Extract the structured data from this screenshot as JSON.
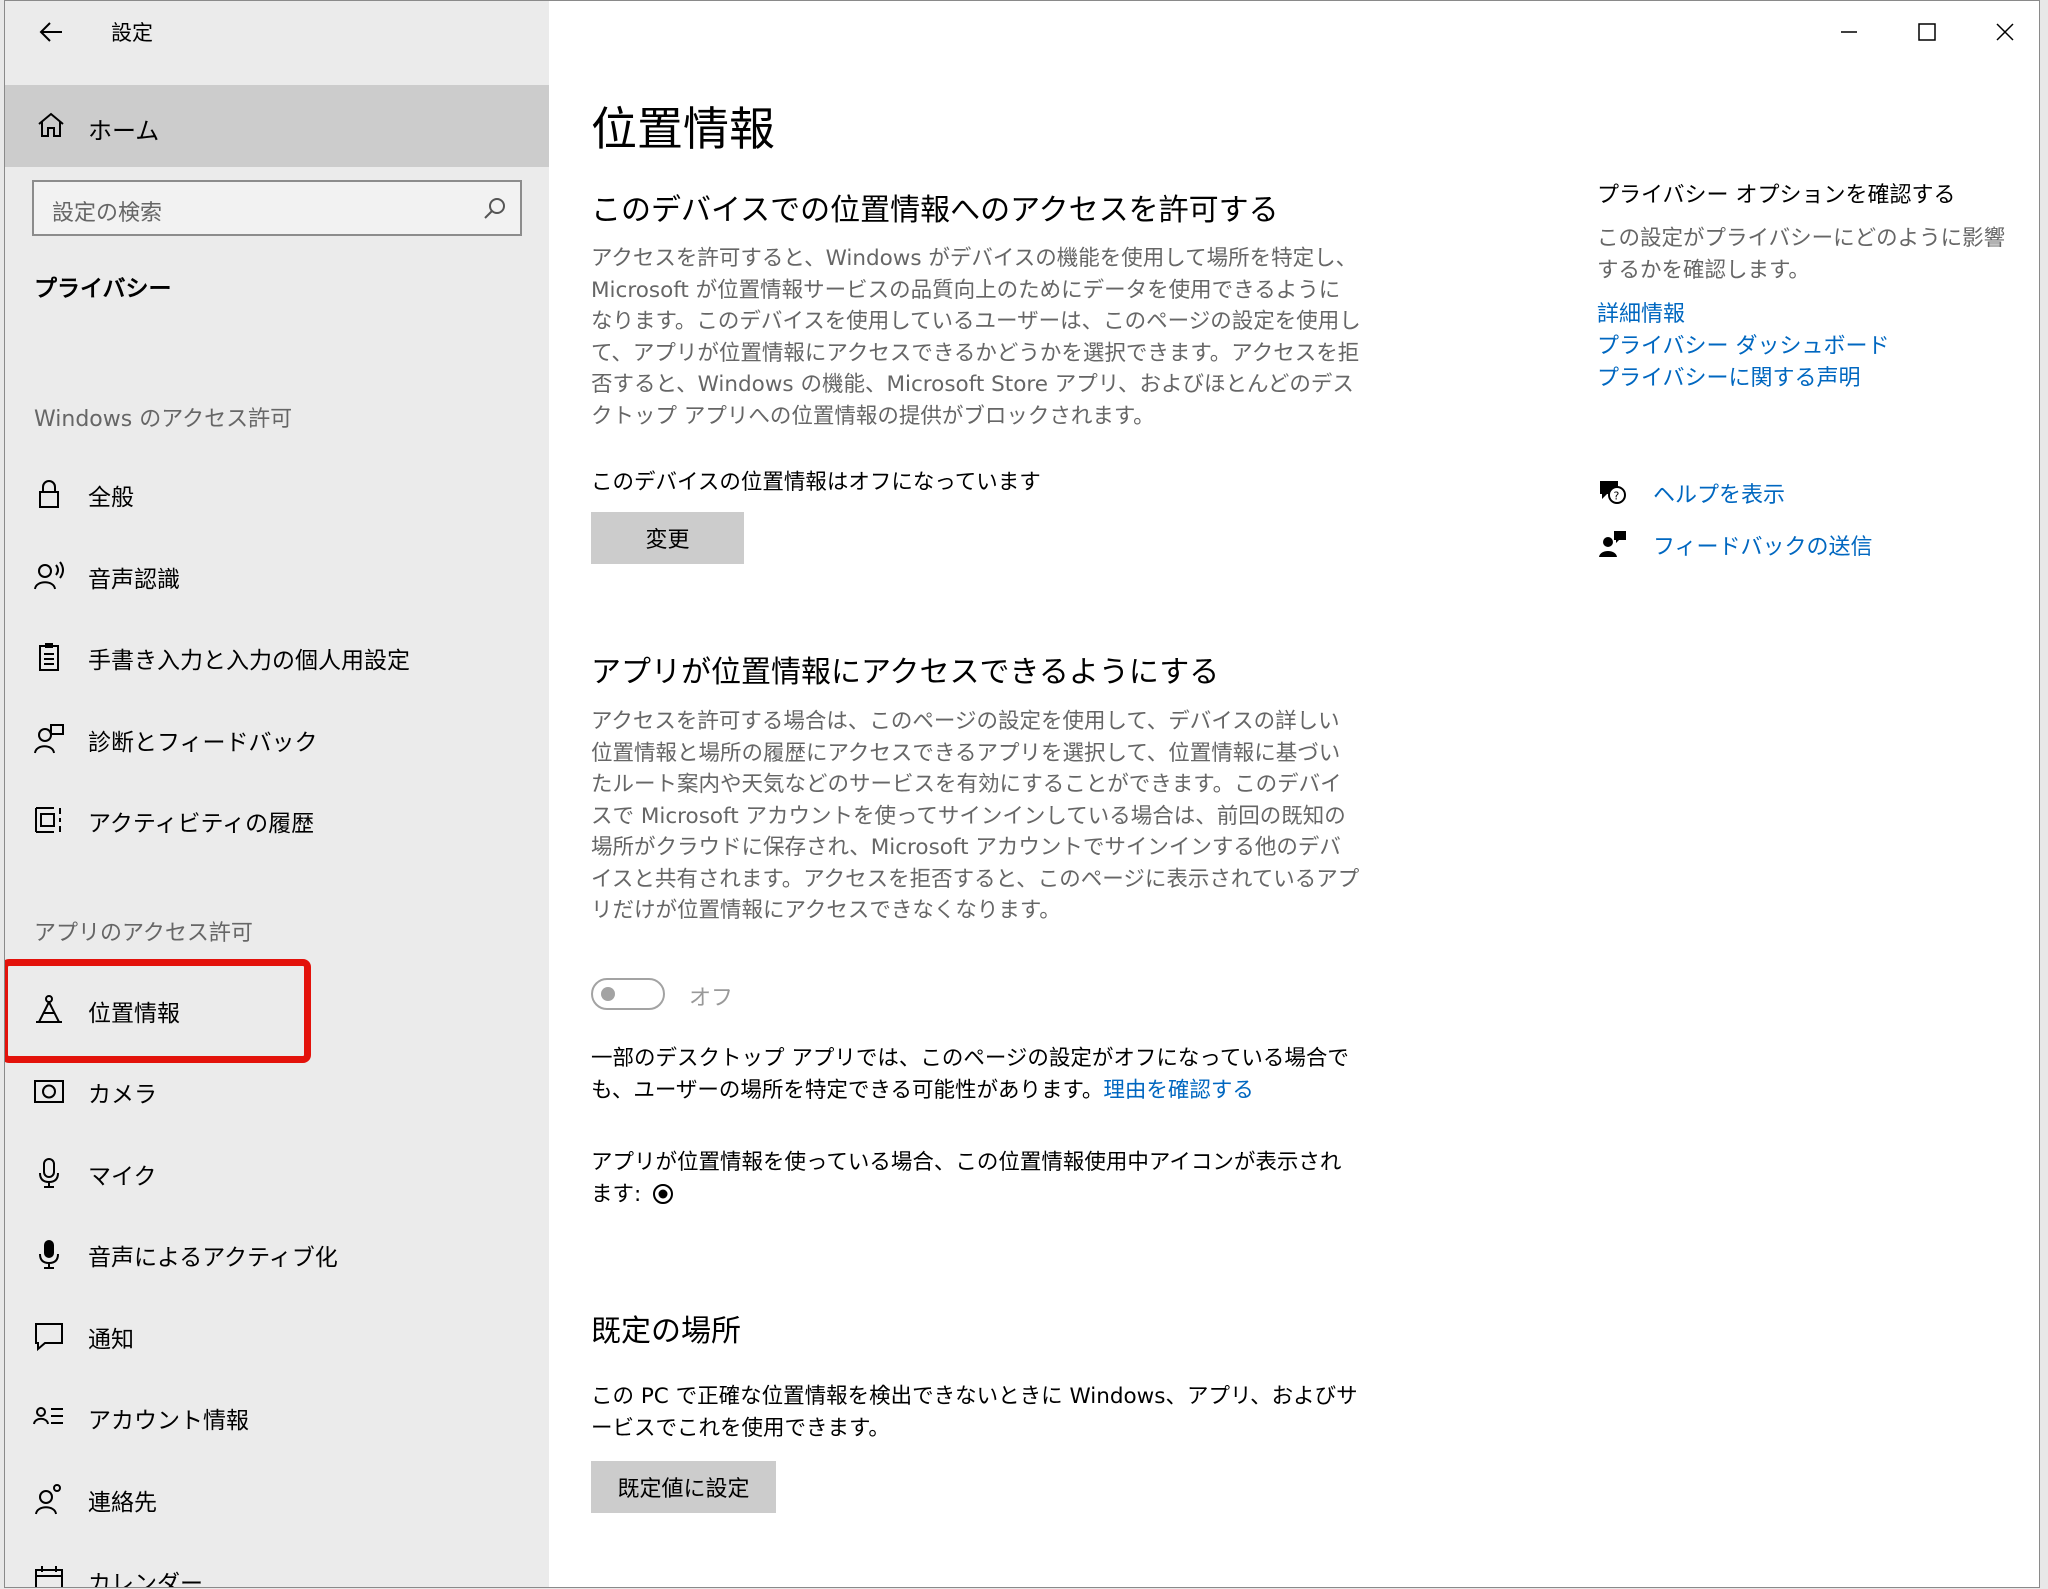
{
  "window": {
    "app_title": "設定",
    "controls": [
      "minimize",
      "maximize",
      "close"
    ]
  },
  "sidebar": {
    "home_label": "ホーム",
    "search_placeholder": "設定の検索",
    "section_title": "プライバシー",
    "windows_group_label": "Windows のアクセス許可",
    "windows_items": [
      {
        "label": "全般",
        "icon": "lock-icon"
      },
      {
        "label": "音声認識",
        "icon": "speech-icon"
      },
      {
        "label": "手書き入力と入力の個人用設定",
        "icon": "clipboard-icon"
      },
      {
        "label": "診断とフィードバック",
        "icon": "feedback-person-icon"
      },
      {
        "label": "アクティビティの履歴",
        "icon": "timeline-icon"
      }
    ],
    "apps_group_label": "アプリのアクセス許可",
    "app_items": [
      {
        "label": "位置情報",
        "icon": "location-icon",
        "selected": true
      },
      {
        "label": "カメラ",
        "icon": "camera-icon"
      },
      {
        "label": "マイク",
        "icon": "microphone-icon"
      },
      {
        "label": "音声によるアクティブ化",
        "icon": "voice-activation-icon"
      },
      {
        "label": "通知",
        "icon": "notification-icon"
      },
      {
        "label": "アカウント情報",
        "icon": "account-info-icon"
      },
      {
        "label": "連絡先",
        "icon": "contacts-icon"
      },
      {
        "label": "カレンダー",
        "icon": "calendar-icon"
      }
    ]
  },
  "main": {
    "page_title": "位置情報",
    "device_section": {
      "heading": "このデバイスでの位置情報へのアクセスを許可する",
      "description": "アクセスを許可すると、Windows がデバイスの機能を使用して場所を特定し、Microsoft が位置情報サービスの品質向上のためにデータを使用できるようになります。このデバイスを使用しているユーザーは、このページの設定を使用して、アプリが位置情報にアクセスできるかどうかを選択できます。アクセスを拒否すると、Windows の機能、Microsoft Store アプリ、およびほとんどのデスクトップ アプリへの位置情報の提供がブロックされます。",
      "status": "このデバイスの位置情報はオフになっています",
      "change_button": "変更"
    },
    "apps_section": {
      "heading": "アプリが位置情報にアクセスできるようにする",
      "description": "アクセスを許可する場合は、このページの設定を使用して、デバイスの詳しい位置情報と場所の履歴にアクセスできるアプリを選択して、位置情報に基づいたルート案内や天気などのサービスを有効にすることができます。このデバイスで Microsoft アカウントを使ってサインインしている場合は、前回の既知の場所がクラウドに保存され、Microsoft アカウントでサインインする他のデバイスと共有されます。アクセスを拒否すると、このページに表示されているアプリだけが位置情報にアクセスできなくなります。",
      "toggle_label": "オフ",
      "toggle_on": false,
      "desktop_note": "一部のデスクトップ アプリでは、このページの設定がオフになっている場合でも、ユーザーの場所を特定できる可能性があります。",
      "desktop_note_link": "理由を確認する",
      "icon_note": "アプリが位置情報を使っている場合、この位置情報使用中アイコンが表示されます:"
    },
    "default_location": {
      "heading": "既定の場所",
      "description": "この PC で正確な位置情報を検出できないときに Windows、アプリ、およびサービスでこれを使用できます。",
      "button": "既定値に設定"
    }
  },
  "right": {
    "title": "プライバシー オプションを確認する",
    "description": "この設定がプライバシーにどのように影響するかを確認します。",
    "links": [
      "詳細情報",
      "プライバシー ダッシュボード",
      "プライバシーに関する声明"
    ],
    "help_label": "ヘルプを表示",
    "feedback_label": "フィードバックの送信"
  },
  "colors": {
    "accent_link": "#0067c0",
    "sidebar_bg": "#ebebeb",
    "selected_bg": "#cccccc",
    "highlight_red": "#e3120b"
  }
}
